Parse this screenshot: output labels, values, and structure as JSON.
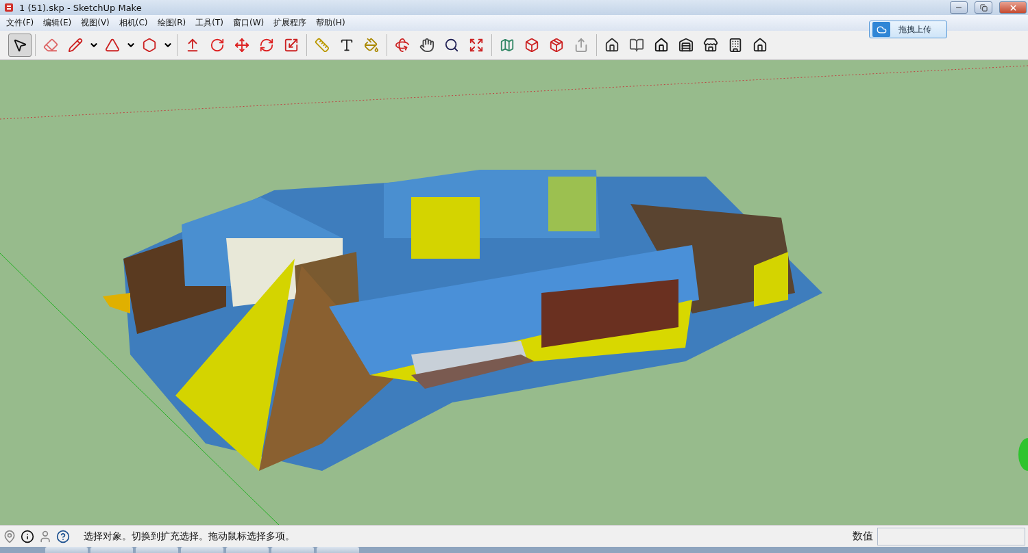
{
  "window": {
    "title": "1 (51).skp - SketchUp Make"
  },
  "menu": [
    {
      "label": "文件(F)"
    },
    {
      "label": "编辑(E)"
    },
    {
      "label": "视图(V)"
    },
    {
      "label": "相机(C)"
    },
    {
      "label": "绘图(R)"
    },
    {
      "label": "工具(T)"
    },
    {
      "label": "窗口(W)"
    },
    {
      "label": "扩展程序"
    },
    {
      "label": "帮助(H)"
    }
  ],
  "upload_button": {
    "label": "拖拽上传"
  },
  "toolbar": {
    "tools": [
      {
        "selected": true
      },
      {
        "selected": false
      },
      {
        "selected": false
      },
      {
        "selected": false
      },
      {
        "selected": false
      },
      {
        "selected": false
      },
      {
        "selected": false
      },
      {
        "selected": false
      },
      {
        "selected": false
      },
      {
        "selected": false
      },
      {
        "selected": false
      },
      {
        "selected": false
      },
      {
        "selected": false
      },
      {
        "selected": false
      },
      {
        "selected": false
      },
      {
        "selected": false
      },
      {
        "selected": false
      },
      {
        "selected": false
      },
      {
        "selected": false
      },
      {
        "selected": false
      },
      {
        "selected": false
      },
      {
        "selected": false
      },
      {
        "selected": false
      },
      {
        "selected": false
      },
      {
        "selected": false
      },
      {
        "selected": false
      },
      {
        "selected": false
      },
      {
        "selected": false
      }
    ]
  },
  "status_bar": {
    "message": "选择对象。切换到扩充选择。拖动鼠标选择多项。",
    "measurements_label": "数值"
  }
}
